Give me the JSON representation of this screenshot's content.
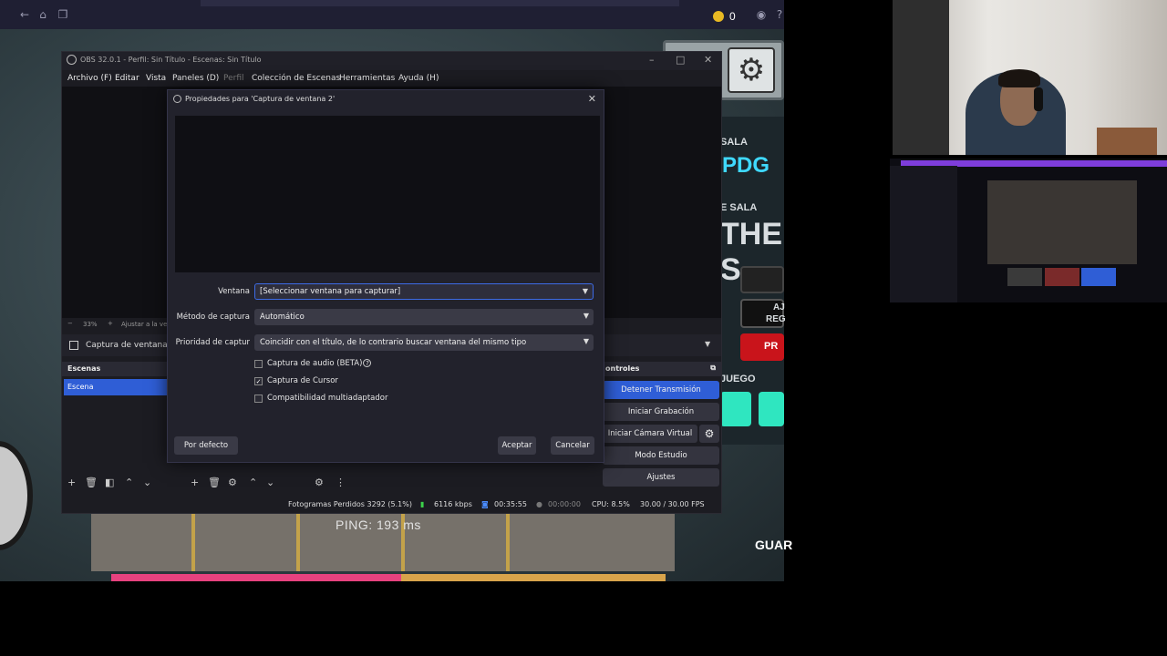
{
  "browser": {
    "coin_count": "0",
    "icons": [
      "back-arrow-icon",
      "home-icon",
      "tabs-icon",
      "coin-icon",
      "user-icon",
      "help-icon"
    ]
  },
  "game": {
    "ping": "PING: 193 ms",
    "side_labels": [
      "SALA",
      "PDG",
      "E SALA",
      "THE S",
      "AJ",
      "REG",
      "PR",
      "JUEGO",
      "GUAR"
    ]
  },
  "obs": {
    "title": "OBS 32.0.1 - Perfil: Sin Título - Escenas: Sin Título",
    "menu": [
      {
        "label": "Archivo (F)",
        "enabled": true
      },
      {
        "label": "Editar",
        "enabled": true
      },
      {
        "label": "Vista",
        "enabled": true
      },
      {
        "label": "Paneles (D)",
        "enabled": true
      },
      {
        "label": "Perfil",
        "enabled": false
      },
      {
        "label": "Colección de Escenas",
        "enabled": true
      },
      {
        "label": "Herramientas",
        "enabled": true
      },
      {
        "label": "Ayuda (H)",
        "enabled": true
      }
    ],
    "zoom": "33%",
    "zoom_fit": "Ajustar a la ve",
    "source_name": "Captura de ventana 2",
    "scenes_header": "Escenas",
    "scene_item": "Escena",
    "controls_header": "ontroles",
    "controls": [
      {
        "label": "Detener Transmisión",
        "active": true
      },
      {
        "label": "Iniciar Grabación",
        "active": false
      },
      {
        "label": "Iniciar Cámara Virtual",
        "active": false
      },
      {
        "label": "Modo Estudio",
        "active": false
      },
      {
        "label": "Ajustes",
        "active": false
      }
    ],
    "status": {
      "dropped": "Fotogramas Perdidos 3292 (5.1%)",
      "bitrate": "6116 kbps",
      "stream_time": "00:35:55",
      "rec_time": "00:00:00",
      "cpu": "CPU: 8.5%",
      "fps": "30.00 / 30.00 FPS"
    }
  },
  "dialog": {
    "title": "Propiedades para 'Captura de ventana 2'",
    "fields": {
      "window_label": "Ventana",
      "window_value": "[Seleccionar ventana para capturar]",
      "method_label": "Método de captura",
      "method_value": "Automático",
      "priority_label": "Prioridad de captur",
      "priority_value": "Coincidir con el título, de lo contrario buscar ventana del mismo tipo"
    },
    "checkboxes": [
      {
        "label": "Captura de audio (BETA)",
        "checked": false
      },
      {
        "label": "Captura de Cursor",
        "checked": true
      },
      {
        "label": "Compatibilidad multiadaptador",
        "checked": false
      }
    ],
    "buttons": {
      "defaults": "Por defecto",
      "ok": "Aceptar",
      "cancel": "Cancelar"
    }
  },
  "colors": {
    "accent": "#2f5ed6",
    "purple_bar": "#7e3ddb",
    "coin": "#e8b923"
  }
}
